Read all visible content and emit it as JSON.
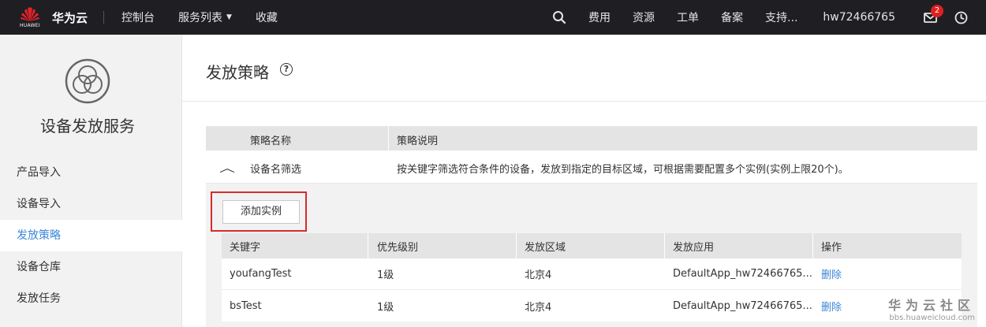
{
  "topbar": {
    "logo_text": "HUAWEI",
    "brand": "华为云",
    "nav": [
      "控制台",
      "服务列表",
      "收藏"
    ],
    "right_items": [
      "费用",
      "资源",
      "工单",
      "备案",
      "支持..."
    ],
    "user": "hw72466765",
    "message_badge": "2",
    "icons": [
      "search-icon",
      "message-icon",
      "clock-icon"
    ]
  },
  "sidebar": {
    "service_title": "设备发放服务",
    "items": [
      "产品导入",
      "设备导入",
      "发放策略",
      "设备仓库",
      "发放任务"
    ],
    "active_index": 2
  },
  "main": {
    "page_title": "发放策略",
    "policy_table": {
      "headers": [
        "策略名称",
        "策略说明"
      ],
      "row": {
        "name": "设备名筛选",
        "description": "按关键字筛选符合条件的设备，发放到指定的目标区域，可根据需要配置多个实例(实例上限20个)。"
      }
    },
    "add_instance_label": "添加实例",
    "instance_table": {
      "headers": [
        "关键字",
        "优先级别",
        "发放区域",
        "发放应用",
        "操作"
      ],
      "rows": [
        {
          "keyword": "youfangTest",
          "priority": "1级",
          "region": "北京4",
          "app": "DefaultApp_hw72466765...",
          "action": "删除"
        },
        {
          "keyword": "bsTest",
          "priority": "1级",
          "region": "北京4",
          "app": "DefaultApp_hw72466765...",
          "action": "删除"
        }
      ]
    }
  },
  "watermark": {
    "title": "华为云社区",
    "url": "bbs.huaweicloud.com"
  },
  "colors": {
    "topbar_bg": "#1f1f23",
    "accent": "#3b87d8",
    "highlight_red": "#d62c2c",
    "badge_red": "#e02020"
  }
}
